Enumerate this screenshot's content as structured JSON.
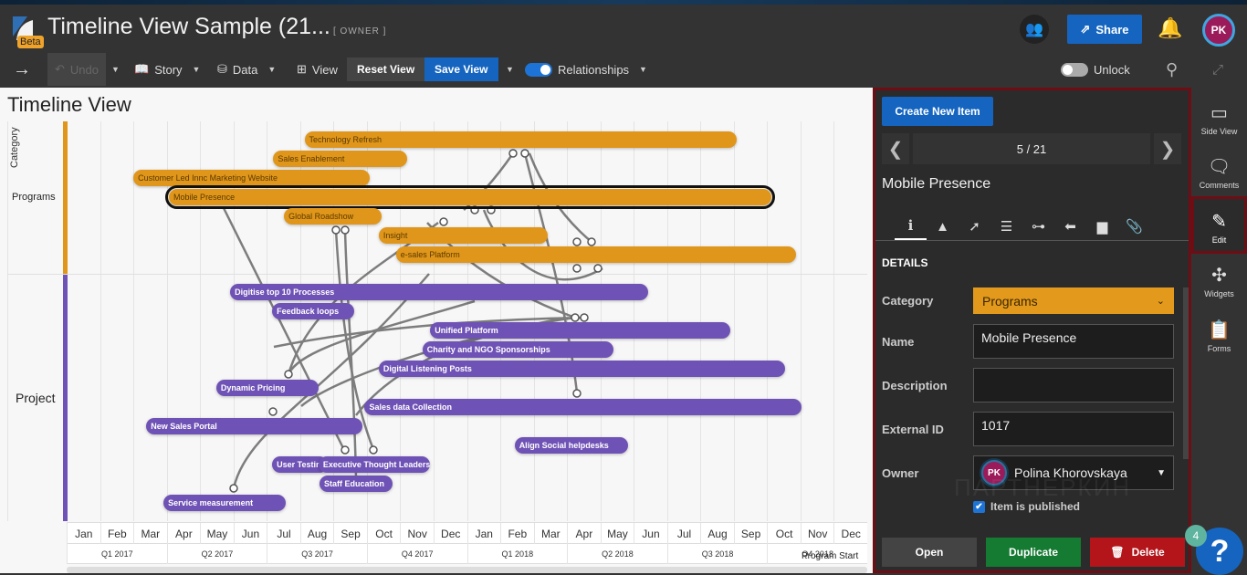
{
  "header": {
    "title": "Timeline View Sample (21...",
    "badge": "Beta",
    "role": "[ OWNER ]",
    "share_label": "Share",
    "avatar_initials": "PK"
  },
  "toolbar": {
    "undo": "Undo",
    "story": "Story",
    "data": "Data",
    "view": "View",
    "reset_view": "Reset View",
    "save_view": "Save View",
    "relationships": "Relationships",
    "relationships_on": true,
    "unlock": "Unlock",
    "unlock_on": false
  },
  "timeline": {
    "title": "Timeline View",
    "category_header": "Category",
    "colors": {
      "Programs": "#e0961a",
      "Project": "#6f52b5"
    },
    "bands": [
      {
        "label": "Programs",
        "type": "prog",
        "rows": [
          [
            {
              "name": "Technology Refresh",
              "start": "2017-08-05",
              "end": "2018-09-04"
            }
          ],
          [
            {
              "name": "Sales Enablement",
              "start": "2017-07-07",
              "end": "2017-11-07"
            }
          ],
          [
            {
              "name": "Customer Led Innc Marketing Website",
              "start": "2017-03-01",
              "end": "2017-10-04"
            }
          ],
          [
            {
              "name": "Mobile Presence",
              "start": "2017-04-03",
              "end": "2018-10-05",
              "selected": true
            }
          ],
          [
            {
              "name": "Global Roadshow",
              "start": "2017-07-17",
              "end": "2017-10-15"
            }
          ],
          [
            {
              "name": "Insight",
              "start": "2017-10-12",
              "end": "2018-03-14"
            }
          ],
          [
            {
              "name": "e-sales Platform",
              "start": "2017-10-28",
              "end": "2018-10-28"
            }
          ]
        ]
      },
      {
        "label": "Project",
        "type": "proj",
        "rows": [
          [
            {
              "name": "Digitise top 10 Processes",
              "start": "2017-05-29",
              "end": "2018-06-14"
            }
          ],
          [
            {
              "name": "Feedback loops",
              "start": "2017-07-06",
              "end": "2017-09-20"
            }
          ],
          [
            {
              "name": "Unified Platform",
              "start": "2017-11-28",
              "end": "2018-08-29"
            }
          ],
          [
            {
              "name": "Charity and NGO Sponsorships",
              "start": "2017-11-21",
              "end": "2018-05-13"
            }
          ],
          [
            {
              "name": "Digital Listening Posts",
              "start": "2017-10-12",
              "end": "2018-10-18"
            }
          ],
          [
            {
              "name": "Dynamic Pricing",
              "start": "2017-05-16",
              "end": "2017-08-18"
            }
          ],
          [
            {
              "name": "Sales data Collection",
              "start": "2017-09-29",
              "end": "2018-11-02"
            }
          ],
          [
            {
              "name": "New Sales Portal",
              "start": "2017-03-13",
              "end": "2017-09-27"
            }
          ],
          [
            {
              "name": "Align Social helpdesks",
              "start": "2018-02-13",
              "end": "2018-05-27"
            }
          ],
          [
            {
              "name": "User Testing",
              "start": "2017-07-06",
              "end": "2017-08-27"
            },
            {
              "name": "Executive Thought Leaders",
              "start": "2017-08-18",
              "end": "2017-11-28"
            }
          ],
          [
            {
              "name": "Staff Education",
              "start": "2017-08-19",
              "end": "2017-10-25"
            }
          ],
          [
            {
              "name": "Service measurement",
              "start": "2017-03-29",
              "end": "2017-07-19"
            }
          ]
        ]
      }
    ],
    "months": [
      "Jan",
      "Feb",
      "Mar",
      "Apr",
      "May",
      "Jun",
      "Jul",
      "Aug",
      "Sep",
      "Oct",
      "Nov",
      "Dec",
      "Jan",
      "Feb",
      "Mar",
      "Apr",
      "May",
      "Jun",
      "Jul",
      "Aug",
      "Sep",
      "Oct",
      "Nov",
      "Dec"
    ],
    "quarters": [
      "Q1 2017",
      "Q2 2017",
      "Q3 2017",
      "Q4 2017",
      "Q1 2018",
      "Q2 2018",
      "Q3 2018",
      "Q4 2018"
    ],
    "axis_start": "2017-01",
    "axis_end": "2018-12",
    "marker_label": "Program Start"
  },
  "panel": {
    "create_label": "Create New Item",
    "pager": "5 / 21",
    "item_title": "Mobile Presence",
    "tabs": [
      "info-icon",
      "image-icon",
      "cursor-click-icon",
      "list-icon",
      "hierarchy-icon",
      "tag-icon",
      "layout-icon",
      "paperclip-icon"
    ],
    "section": "DETAILS",
    "fields": {
      "category_label": "Category",
      "category_value": "Programs",
      "name_label": "Name",
      "name_value": "Mobile Presence",
      "description_label": "Description",
      "description_value": "",
      "external_id_label": "External ID",
      "external_id_value": "1017",
      "owner_label": "Owner",
      "owner_value": "Polina Khorovskaya",
      "owner_initials": "PK"
    },
    "published_label": "Item is published",
    "published": true,
    "open_label": "Open",
    "duplicate_label": "Duplicate",
    "delete_label": "Delete"
  },
  "sidebar": {
    "items": [
      {
        "label": "Side View"
      },
      {
        "label": "Comments"
      },
      {
        "label": "Edit"
      },
      {
        "label": "Widgets"
      },
      {
        "label": "Forms"
      }
    ]
  },
  "help": {
    "badge": "4",
    "label": "?"
  },
  "watermark": "ПАРТНЕРКИН"
}
